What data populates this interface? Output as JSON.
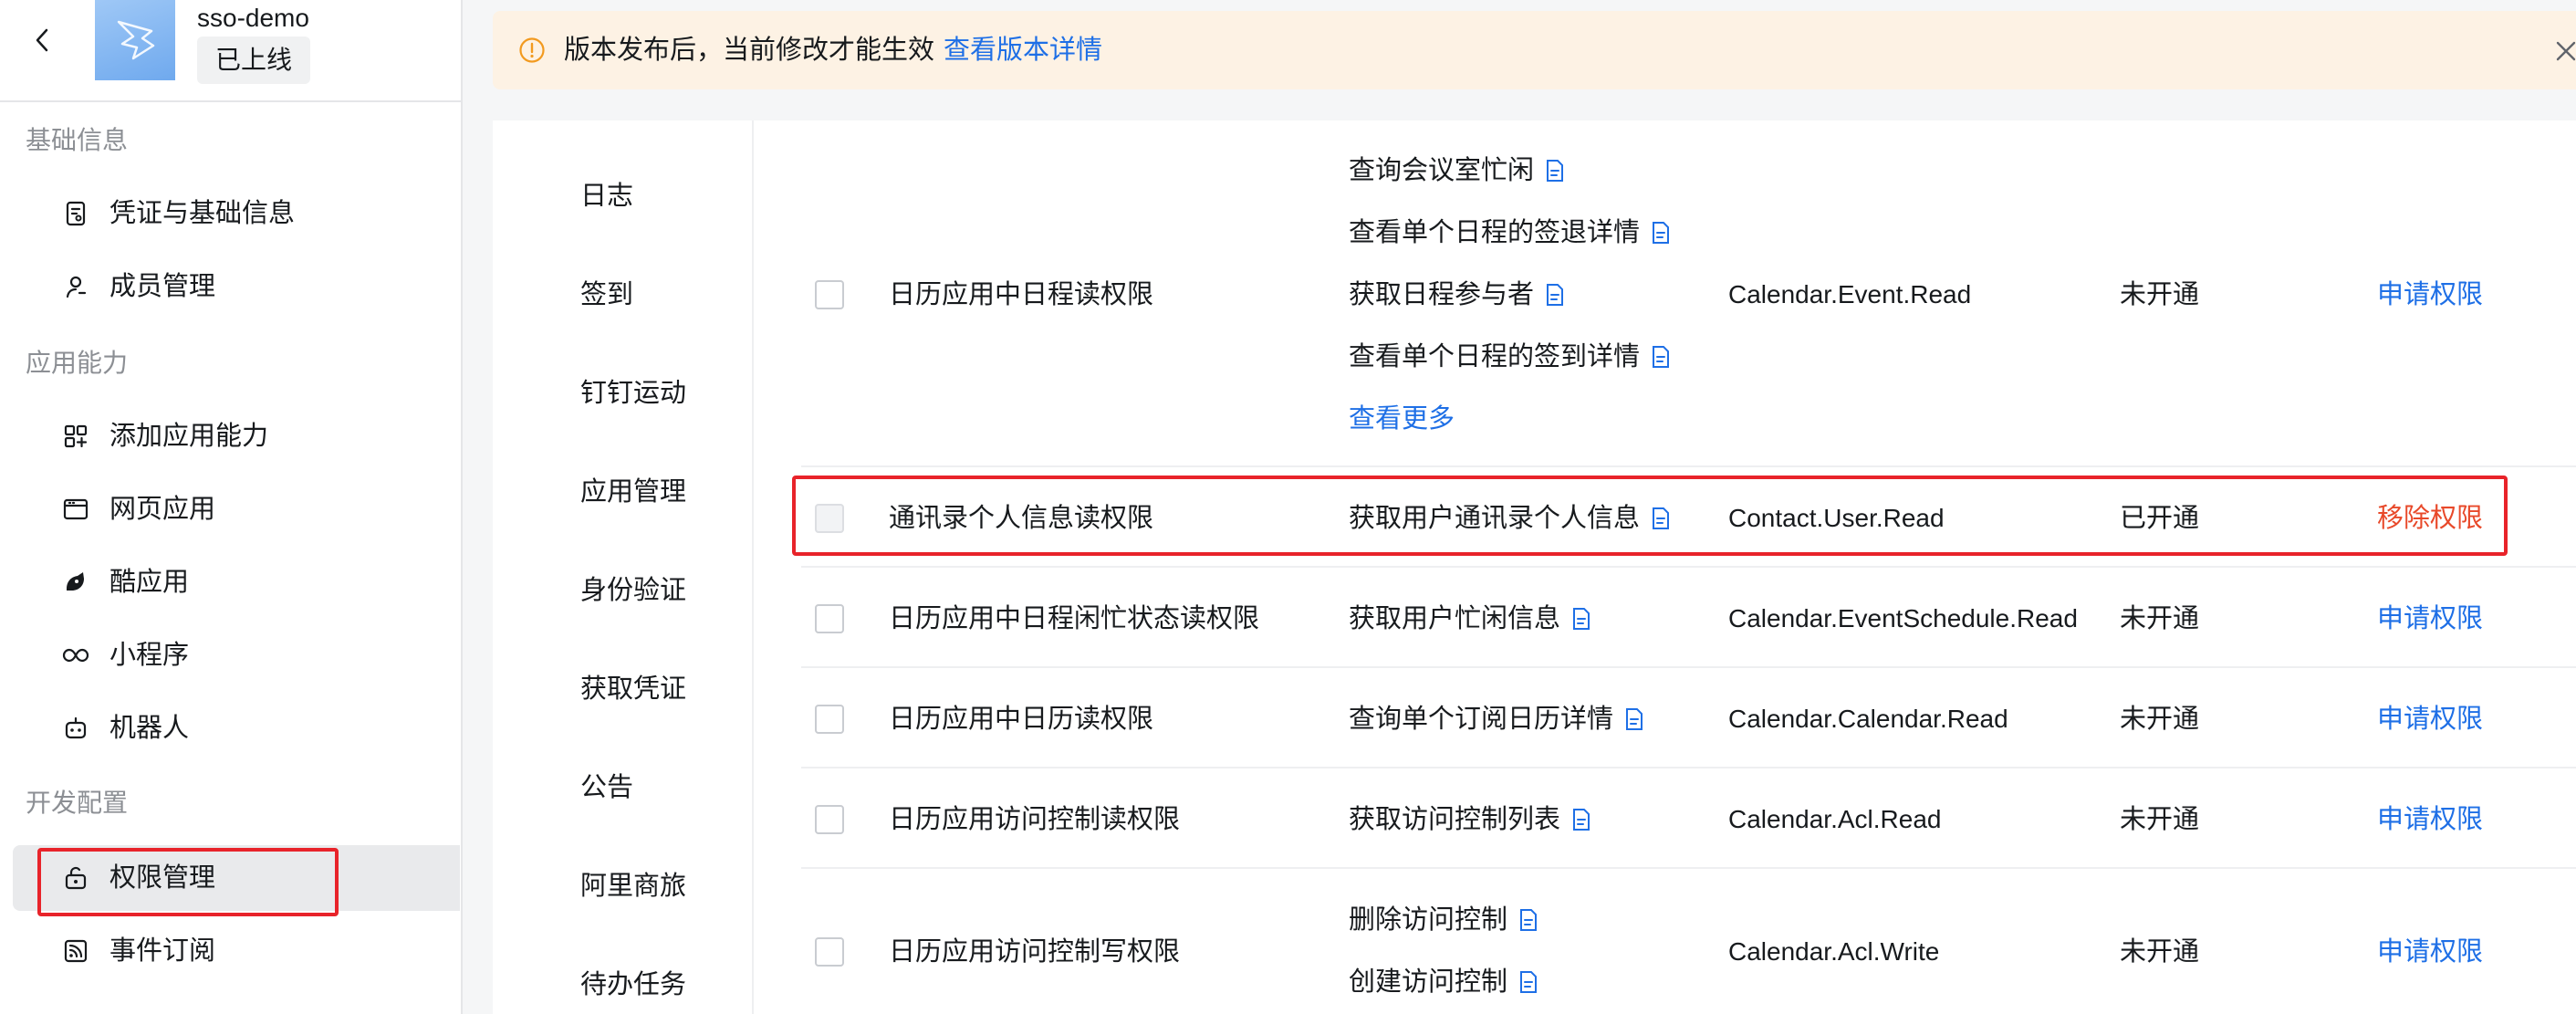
{
  "app": {
    "name": "sso-demo",
    "status": "已上线"
  },
  "sidebar": {
    "sections": [
      {
        "title": "基础信息"
      },
      {
        "title": "应用能力"
      },
      {
        "title": "开发配置"
      }
    ],
    "items": [
      {
        "label": "凭证与基础信息",
        "icon": "credential-icon"
      },
      {
        "label": "成员管理",
        "icon": "user-icon"
      },
      {
        "label": "添加应用能力",
        "icon": "add-capability-icon"
      },
      {
        "label": "网页应用",
        "icon": "browser-icon"
      },
      {
        "label": "酷应用",
        "icon": "cool-app-icon"
      },
      {
        "label": "小程序",
        "icon": "mini-program-icon"
      },
      {
        "label": "机器人",
        "icon": "robot-icon"
      },
      {
        "label": "权限管理",
        "icon": "permission-lock-icon",
        "active": true
      },
      {
        "label": "事件订阅",
        "icon": "subscription-icon"
      }
    ]
  },
  "notice": {
    "text": "版本发布后，当前修改才能生效",
    "link": "查看版本详情"
  },
  "categories": [
    "日志",
    "签到",
    "钉钉运动",
    "应用管理",
    "身份验证",
    "获取凭证",
    "公告",
    "阿里商旅",
    "待办任务"
  ],
  "permissions": [
    {
      "name": "日历应用中日程读权限",
      "apis": [
        "查询会议室忙闲",
        "查看单个日程的签退详情",
        "获取日程参与者",
        "查看单个日程的签到详情"
      ],
      "more": "查看更多",
      "code": "Calendar.Event.Read",
      "status": "未开通",
      "action": "申请权限"
    },
    {
      "name": "通讯录个人信息读权限",
      "apis": [
        "获取用户通讯录个人信息"
      ],
      "code": "Contact.User.Read",
      "status": "已开通",
      "action": "移除权限"
    },
    {
      "name": "日历应用中日程闲忙状态读权限",
      "apis": [
        "获取用户忙闲信息"
      ],
      "code": "Calendar.EventSchedule.Read",
      "status": "未开通",
      "action": "申请权限"
    },
    {
      "name": "日历应用中日历读权限",
      "apis": [
        "查询单个订阅日历详情"
      ],
      "code": "Calendar.Calendar.Read",
      "status": "未开通",
      "action": "申请权限"
    },
    {
      "name": "日历应用访问控制读权限",
      "apis": [
        "获取访问控制列表"
      ],
      "code": "Calendar.Acl.Read",
      "status": "未开通",
      "action": "申请权限"
    },
    {
      "name": "日历应用访问控制写权限",
      "apis": [
        "删除访问控制",
        "创建访问控制"
      ],
      "code": "Calendar.Acl.Write",
      "status": "未开通",
      "action": "申请权限"
    }
  ],
  "colors": {
    "link": "#1e6fe6",
    "danger": "#e8492a",
    "highlight": "#e8232a",
    "notice_bg": "#fdf2e4"
  }
}
